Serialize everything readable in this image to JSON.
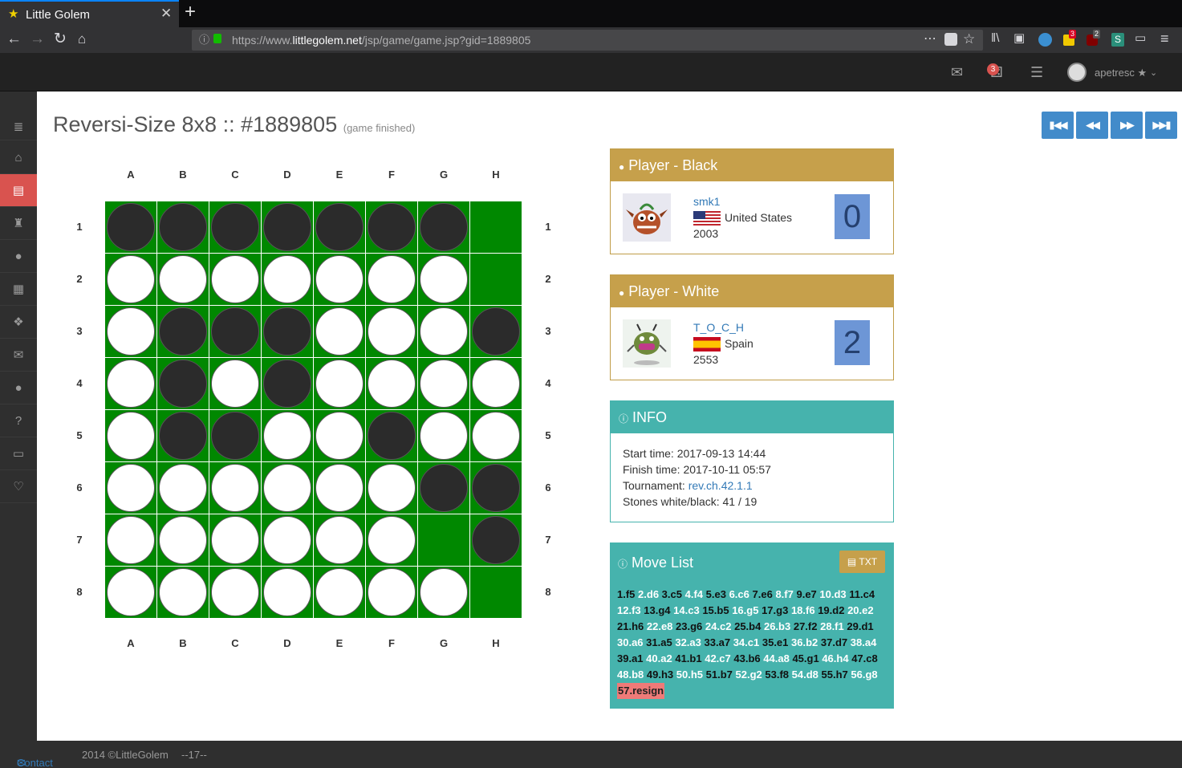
{
  "browser": {
    "tab_title": "Little Golem",
    "url_prefix": "https://www.",
    "url_domain": "littlegolem.net",
    "url_path": "/jsp/game/game.jsp?gid=1889805",
    "ext_badge_1": "3",
    "ext_badge_2": "2"
  },
  "header": {
    "notification_count": "3",
    "username": "apetresc ★"
  },
  "sidebar": {
    "items": [
      "menu-icon",
      "home-icon",
      "games-icon",
      "tournament-icon",
      "users-icon",
      "calendar-icon",
      "cubes-icon",
      "mail-icon",
      "group-icon",
      "help-icon",
      "money-icon",
      "heart-icon"
    ],
    "active": "games-icon"
  },
  "page": {
    "title": "Reversi-Size 8x8 :: #1889805",
    "subtitle": "(game finished)"
  },
  "board": {
    "columns": [
      "A",
      "B",
      "C",
      "D",
      "E",
      "F",
      "G",
      "H"
    ],
    "rows": [
      "1",
      "2",
      "3",
      "4",
      "5",
      "6",
      "7",
      "8"
    ],
    "cells": [
      "bbbbbbb.",
      "wwwwwww.",
      "wbbbwwwb",
      "wbwbwwww",
      "wbbwwbww",
      "wwwwwwbb",
      "wwwwww.b",
      "wwwwwww."
    ]
  },
  "black_player": {
    "heading": "Player - Black",
    "name": "smk1",
    "country": "United States",
    "rating": "2003",
    "score": "0"
  },
  "white_player": {
    "heading": "Player - White",
    "name": "T_O_C_H",
    "country": "Spain",
    "rating": "2553",
    "score": "2"
  },
  "info": {
    "heading": "INFO",
    "start_label": "Start time: ",
    "start": "2017-09-13 14:44",
    "finish_label": "Finish time: ",
    "finish": "2017-10-11 05:57",
    "tournament_label": "Tournament: ",
    "tournament": "rev.ch.42.1.1",
    "stones_label": "Stones white/black: ",
    "stones": "41 / 19"
  },
  "move_list": {
    "heading": "Move List",
    "txt_button": "TXT",
    "moves": [
      "1.f5",
      "2.d6",
      "3.c5",
      "4.f4",
      "5.e3",
      "6.c6",
      "7.e6",
      "8.f7",
      "9.e7",
      "10.d3",
      "11.c4",
      "12.f3",
      "13.g4",
      "14.c3",
      "15.b5",
      "16.g5",
      "17.g3",
      "18.f6",
      "19.d2",
      "20.e2",
      "21.h6",
      "22.e8",
      "23.g6",
      "24.c2",
      "25.b4",
      "26.b3",
      "27.f2",
      "28.f1",
      "29.d1",
      "30.a6",
      "31.a5",
      "32.a3",
      "33.a7",
      "34.c1",
      "35.e1",
      "36.b2",
      "37.d7",
      "38.a4",
      "39.a1",
      "40.a2",
      "41.b1",
      "42.c7",
      "43.b6",
      "44.a8",
      "45.g1",
      "46.h4",
      "47.c8",
      "48.b8",
      "49.h3",
      "50.h5",
      "51.b7",
      "52.g2",
      "53.f8",
      "54.d8",
      "55.h7",
      "56.g8",
      "57.resign"
    ]
  },
  "footer": {
    "contact": "Contact",
    "copyright": "2014 ©LittleGolem",
    "version": "--17--"
  },
  "colors": {
    "board_green": "#008800",
    "gold": "#c6a04b",
    "teal": "#46b3ad",
    "nav_blue": "#428bca"
  }
}
